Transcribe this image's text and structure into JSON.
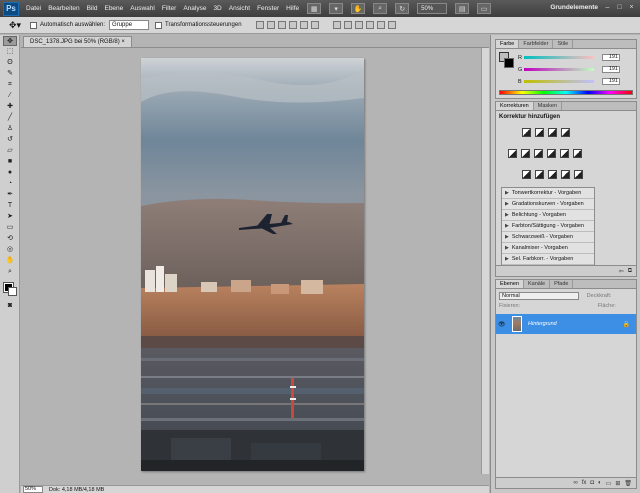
{
  "menubar": {
    "logo": "Ps",
    "items": [
      "Datei",
      "Bearbeiten",
      "Bild",
      "Ebene",
      "Auswahl",
      "Filter",
      "Analyse",
      "3D",
      "Ansicht",
      "Fenster",
      "Hilfe"
    ],
    "zoom": "50%",
    "workspace": "Grundelemente"
  },
  "options": {
    "auto_select_label": "Automatisch auswählen:",
    "auto_select_value": "Gruppe",
    "transform_label": "Transformationssteuerungen"
  },
  "document": {
    "tab_title": "DSC_1378.JPG bei 50% (RGB/8) ×"
  },
  "status": {
    "zoom": "50%",
    "info": "Dok: 4,18 MB/4,18 MB"
  },
  "color_panel": {
    "tabs": [
      "Farbe",
      "Farbfelder",
      "Stile"
    ],
    "channels": [
      {
        "label": "R",
        "value": "191",
        "accent": "#e05050"
      },
      {
        "label": "G",
        "value": "191",
        "accent": "#50c050"
      },
      {
        "label": "B",
        "value": "191",
        "accent": "#5070e0"
      }
    ]
  },
  "adjustments_panel": {
    "tabs": [
      "Korrekturen",
      "Masken"
    ],
    "heading": "Korrektur hinzufügen",
    "presets": [
      "Tonwertkorrektur - Vorgaben",
      "Gradationskurven - Vorgaben",
      "Belichtung - Vorgaben",
      "Farbton/Sättigung - Vorgaben",
      "Schwarzweiß - Vorgaben",
      "Kanalmixer - Vorgaben",
      "Sel. Farbkorr. - Vorgaben"
    ]
  },
  "layers_panel": {
    "tabs": [
      "Ebenen",
      "Kanäle",
      "Pfade"
    ],
    "blend_mode": "Normal",
    "opacity_label": "Deckkraft:",
    "lock_label": "Fixieren:",
    "fill_label": "Fläche:",
    "layers": [
      {
        "name": "Hintergrund",
        "selected_color": "#3d8ee5"
      }
    ]
  },
  "tools": [
    "move",
    "marquee",
    "lasso",
    "quick-select",
    "crop",
    "eyedropper",
    "healing",
    "brush",
    "stamp",
    "history-brush",
    "eraser",
    "gradient",
    "blur",
    "dodge",
    "pen",
    "type",
    "path-select",
    "shape",
    "3d-rotate",
    "3d-orbit",
    "hand",
    "zoom"
  ]
}
